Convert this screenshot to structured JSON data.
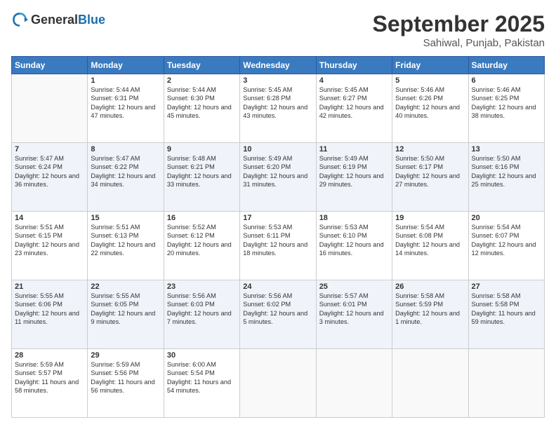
{
  "logo": {
    "general": "General",
    "blue": "Blue"
  },
  "header": {
    "month": "September 2025",
    "location": "Sahiwal, Punjab, Pakistan"
  },
  "weekdays": [
    "Sunday",
    "Monday",
    "Tuesday",
    "Wednesday",
    "Thursday",
    "Friday",
    "Saturday"
  ],
  "weeks": [
    [
      {
        "day": "",
        "sunrise": "",
        "sunset": "",
        "daylight": ""
      },
      {
        "day": "1",
        "sunrise": "Sunrise: 5:44 AM",
        "sunset": "Sunset: 6:31 PM",
        "daylight": "Daylight: 12 hours and 47 minutes."
      },
      {
        "day": "2",
        "sunrise": "Sunrise: 5:44 AM",
        "sunset": "Sunset: 6:30 PM",
        "daylight": "Daylight: 12 hours and 45 minutes."
      },
      {
        "day": "3",
        "sunrise": "Sunrise: 5:45 AM",
        "sunset": "Sunset: 6:28 PM",
        "daylight": "Daylight: 12 hours and 43 minutes."
      },
      {
        "day": "4",
        "sunrise": "Sunrise: 5:45 AM",
        "sunset": "Sunset: 6:27 PM",
        "daylight": "Daylight: 12 hours and 42 minutes."
      },
      {
        "day": "5",
        "sunrise": "Sunrise: 5:46 AM",
        "sunset": "Sunset: 6:26 PM",
        "daylight": "Daylight: 12 hours and 40 minutes."
      },
      {
        "day": "6",
        "sunrise": "Sunrise: 5:46 AM",
        "sunset": "Sunset: 6:25 PM",
        "daylight": "Daylight: 12 hours and 38 minutes."
      }
    ],
    [
      {
        "day": "7",
        "sunrise": "Sunrise: 5:47 AM",
        "sunset": "Sunset: 6:24 PM",
        "daylight": "Daylight: 12 hours and 36 minutes."
      },
      {
        "day": "8",
        "sunrise": "Sunrise: 5:47 AM",
        "sunset": "Sunset: 6:22 PM",
        "daylight": "Daylight: 12 hours and 34 minutes."
      },
      {
        "day": "9",
        "sunrise": "Sunrise: 5:48 AM",
        "sunset": "Sunset: 6:21 PM",
        "daylight": "Daylight: 12 hours and 33 minutes."
      },
      {
        "day": "10",
        "sunrise": "Sunrise: 5:49 AM",
        "sunset": "Sunset: 6:20 PM",
        "daylight": "Daylight: 12 hours and 31 minutes."
      },
      {
        "day": "11",
        "sunrise": "Sunrise: 5:49 AM",
        "sunset": "Sunset: 6:19 PM",
        "daylight": "Daylight: 12 hours and 29 minutes."
      },
      {
        "day": "12",
        "sunrise": "Sunrise: 5:50 AM",
        "sunset": "Sunset: 6:17 PM",
        "daylight": "Daylight: 12 hours and 27 minutes."
      },
      {
        "day": "13",
        "sunrise": "Sunrise: 5:50 AM",
        "sunset": "Sunset: 6:16 PM",
        "daylight": "Daylight: 12 hours and 25 minutes."
      }
    ],
    [
      {
        "day": "14",
        "sunrise": "Sunrise: 5:51 AM",
        "sunset": "Sunset: 6:15 PM",
        "daylight": "Daylight: 12 hours and 23 minutes."
      },
      {
        "day": "15",
        "sunrise": "Sunrise: 5:51 AM",
        "sunset": "Sunset: 6:13 PM",
        "daylight": "Daylight: 12 hours and 22 minutes."
      },
      {
        "day": "16",
        "sunrise": "Sunrise: 5:52 AM",
        "sunset": "Sunset: 6:12 PM",
        "daylight": "Daylight: 12 hours and 20 minutes."
      },
      {
        "day": "17",
        "sunrise": "Sunrise: 5:53 AM",
        "sunset": "Sunset: 6:11 PM",
        "daylight": "Daylight: 12 hours and 18 minutes."
      },
      {
        "day": "18",
        "sunrise": "Sunrise: 5:53 AM",
        "sunset": "Sunset: 6:10 PM",
        "daylight": "Daylight: 12 hours and 16 minutes."
      },
      {
        "day": "19",
        "sunrise": "Sunrise: 5:54 AM",
        "sunset": "Sunset: 6:08 PM",
        "daylight": "Daylight: 12 hours and 14 minutes."
      },
      {
        "day": "20",
        "sunrise": "Sunrise: 5:54 AM",
        "sunset": "Sunset: 6:07 PM",
        "daylight": "Daylight: 12 hours and 12 minutes."
      }
    ],
    [
      {
        "day": "21",
        "sunrise": "Sunrise: 5:55 AM",
        "sunset": "Sunset: 6:06 PM",
        "daylight": "Daylight: 12 hours and 11 minutes."
      },
      {
        "day": "22",
        "sunrise": "Sunrise: 5:55 AM",
        "sunset": "Sunset: 6:05 PM",
        "daylight": "Daylight: 12 hours and 9 minutes."
      },
      {
        "day": "23",
        "sunrise": "Sunrise: 5:56 AM",
        "sunset": "Sunset: 6:03 PM",
        "daylight": "Daylight: 12 hours and 7 minutes."
      },
      {
        "day": "24",
        "sunrise": "Sunrise: 5:56 AM",
        "sunset": "Sunset: 6:02 PM",
        "daylight": "Daylight: 12 hours and 5 minutes."
      },
      {
        "day": "25",
        "sunrise": "Sunrise: 5:57 AM",
        "sunset": "Sunset: 6:01 PM",
        "daylight": "Daylight: 12 hours and 3 minutes."
      },
      {
        "day": "26",
        "sunrise": "Sunrise: 5:58 AM",
        "sunset": "Sunset: 5:59 PM",
        "daylight": "Daylight: 12 hours and 1 minute."
      },
      {
        "day": "27",
        "sunrise": "Sunrise: 5:58 AM",
        "sunset": "Sunset: 5:58 PM",
        "daylight": "Daylight: 11 hours and 59 minutes."
      }
    ],
    [
      {
        "day": "28",
        "sunrise": "Sunrise: 5:59 AM",
        "sunset": "Sunset: 5:57 PM",
        "daylight": "Daylight: 11 hours and 58 minutes."
      },
      {
        "day": "29",
        "sunrise": "Sunrise: 5:59 AM",
        "sunset": "Sunset: 5:56 PM",
        "daylight": "Daylight: 11 hours and 56 minutes."
      },
      {
        "day": "30",
        "sunrise": "Sunrise: 6:00 AM",
        "sunset": "Sunset: 5:54 PM",
        "daylight": "Daylight: 11 hours and 54 minutes."
      },
      {
        "day": "",
        "sunrise": "",
        "sunset": "",
        "daylight": ""
      },
      {
        "day": "",
        "sunrise": "",
        "sunset": "",
        "daylight": ""
      },
      {
        "day": "",
        "sunrise": "",
        "sunset": "",
        "daylight": ""
      },
      {
        "day": "",
        "sunrise": "",
        "sunset": "",
        "daylight": ""
      }
    ]
  ]
}
